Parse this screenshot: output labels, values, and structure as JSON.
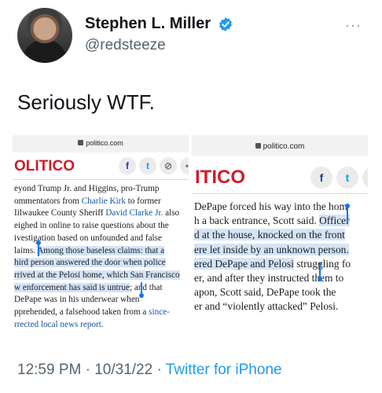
{
  "author": {
    "name": "Stephen L. Miller",
    "handle": "@redsteeze",
    "verified": true,
    "avatar_icon": "profile-photo"
  },
  "more_label": "···",
  "tweet": {
    "text": "Seriously WTF."
  },
  "screenshots": {
    "left": {
      "url": "politico.com",
      "logo": "OLITICO",
      "share": {
        "facebook": "f",
        "twitter": "t",
        "link": "⊘",
        "more": "••"
      },
      "lines": [
        {
          "pre": "eyond Trump Jr. and Higgins, pro-Trump"
        },
        {
          "pre": "ommentators from ",
          "link": "Charlie Kirk",
          "post": " to former"
        },
        {
          "pre": "Iilwaukee County Sheriff ",
          "link": "David Clarke Jr.",
          "post": " also"
        },
        {
          "pre": "eighed in online to raise questions about the"
        },
        {
          "pre": "ivestigation based on unfounded and false"
        },
        {
          "pre": "laims. ",
          "hl": "Among those baseless claims: that a"
        },
        {
          "hl": "hird person answered the door when police"
        },
        {
          "hl": "rrived at the Pelosi home, which San Francisco"
        },
        {
          "hl": "w enforcement has said is untrue",
          "post": "; and that"
        },
        {
          "pre": "DePape was in his underwear when"
        },
        {
          "pre": "pprehended, a falsehood taken from a ",
          "link": "since-"
        },
        {
          "link": "rrected local news report",
          "post": "."
        }
      ]
    },
    "right": {
      "url": "politico.com",
      "logo": "ITICO",
      "share": {
        "facebook": "f",
        "twitter": "t",
        "link": "⊘"
      },
      "lines": [
        {
          "pre": "DePape forced his way into the hom"
        },
        {
          "pre": "h a back entrance, Scott said. ",
          "hl": "Officer"
        },
        {
          "hl": "d at the house, knocked on the front"
        },
        {
          "hl": "ere let inside by an unknown person."
        },
        {
          "hl": "ered DePape and Pelosi",
          "post": " struggling fo"
        },
        {
          "pre": "er, and after they instructed them to"
        },
        {
          "pre": "apon, Scott said, DePape took the"
        },
        {
          "pre": "er and “violently attacked” Pelosi."
        }
      ]
    }
  },
  "meta": {
    "time": "12:59 PM",
    "separator": " · ",
    "date": "10/31/22",
    "source": "Twitter for iPhone"
  },
  "colors": {
    "twitter_blue": "#1d9bf0",
    "politico_red": "#d01c2a",
    "selection_highlight": "#d4e4f7",
    "selection_handle": "#1a73e8"
  }
}
